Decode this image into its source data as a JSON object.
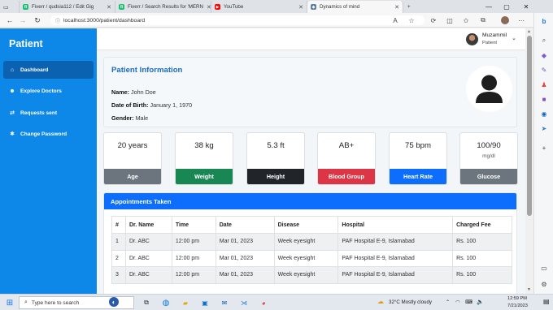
{
  "browser": {
    "tabs": [
      {
        "title": "Fiverr / qudsia112 / Edit Gig",
        "favicon_color": "#1dbf73",
        "favicon_glyph": "fi"
      },
      {
        "title": "Fiverr / Search Results for 'MERN",
        "favicon_color": "#1dbf73",
        "favicon_glyph": "fi"
      },
      {
        "title": "YouTube",
        "favicon_color": "#ff0000",
        "favicon_glyph": "▶"
      },
      {
        "title": "Dynamics of mind",
        "favicon_color": "#5a7da8",
        "favicon_glyph": "◆"
      }
    ],
    "url": "localhost:3000/patient/dashboard"
  },
  "sidebar": {
    "brand": "Patient",
    "items": [
      {
        "label": "Dashboard",
        "icon": "home-icon",
        "active": true
      },
      {
        "label": "Explore Doctors",
        "icon": "users-icon",
        "active": false
      },
      {
        "label": "Requests sent",
        "icon": "arrows-icon",
        "active": false
      },
      {
        "label": "Change Password",
        "icon": "settings-icon",
        "active": false
      }
    ]
  },
  "user": {
    "name": "Muzammil",
    "role": "Patient"
  },
  "patient_info": {
    "title": "Patient Information",
    "name_label": "Name:",
    "name": "John Doe",
    "dob_label": "Date of Birth:",
    "dob": "January 1, 1970",
    "gender_label": "Gender:",
    "gender": "Male"
  },
  "stats": [
    {
      "value": "20 years",
      "unit": "",
      "label": "Age",
      "color": "#6c757d"
    },
    {
      "value": "38 kg",
      "unit": "",
      "label": "Weight",
      "color": "#198754"
    },
    {
      "value": "5.3 ft",
      "unit": "",
      "label": "Height",
      "color": "#212529"
    },
    {
      "value": "AB+",
      "unit": "",
      "label": "Blood Group",
      "color": "#dc3545"
    },
    {
      "value": "75 bpm",
      "unit": "",
      "label": "Heart Rate",
      "color": "#0d6efd"
    },
    {
      "value": "100/90",
      "unit": "mg/dl",
      "label": "Glucose",
      "color": "#6c757d"
    }
  ],
  "appointments": {
    "title": "Appointments Taken",
    "columns": [
      "#",
      "Dr. Name",
      "Time",
      "Date",
      "Disease",
      "Hospital",
      "Charged Fee"
    ],
    "rows": [
      [
        "1",
        "Dr. ABC",
        "12:00 pm",
        "Mar 01, 2023",
        "Week eyesight",
        "PAF Hospital E-9, Islamabad",
        "Rs. 100"
      ],
      [
        "2",
        "Dr. ABC",
        "12:00 pm",
        "Mar 01, 2023",
        "Week eyesight",
        "PAF Hospital E-9, Islamabad",
        "Rs. 100"
      ],
      [
        "3",
        "Dr. ABC",
        "12:00 pm",
        "Mar 01, 2023",
        "Week eyesight",
        "PAF Hospital E-9, Islamabad",
        "Rs. 100"
      ]
    ]
  },
  "taskbar": {
    "search_placeholder": "Type here to search",
    "weather": "32°C  Mostly cloudy",
    "time": "12:59 PM",
    "date": "7/21/2023"
  },
  "colors": {
    "sidebar": "#0d87e8",
    "accent": "#0d6efd",
    "title": "#1a6cc4"
  }
}
